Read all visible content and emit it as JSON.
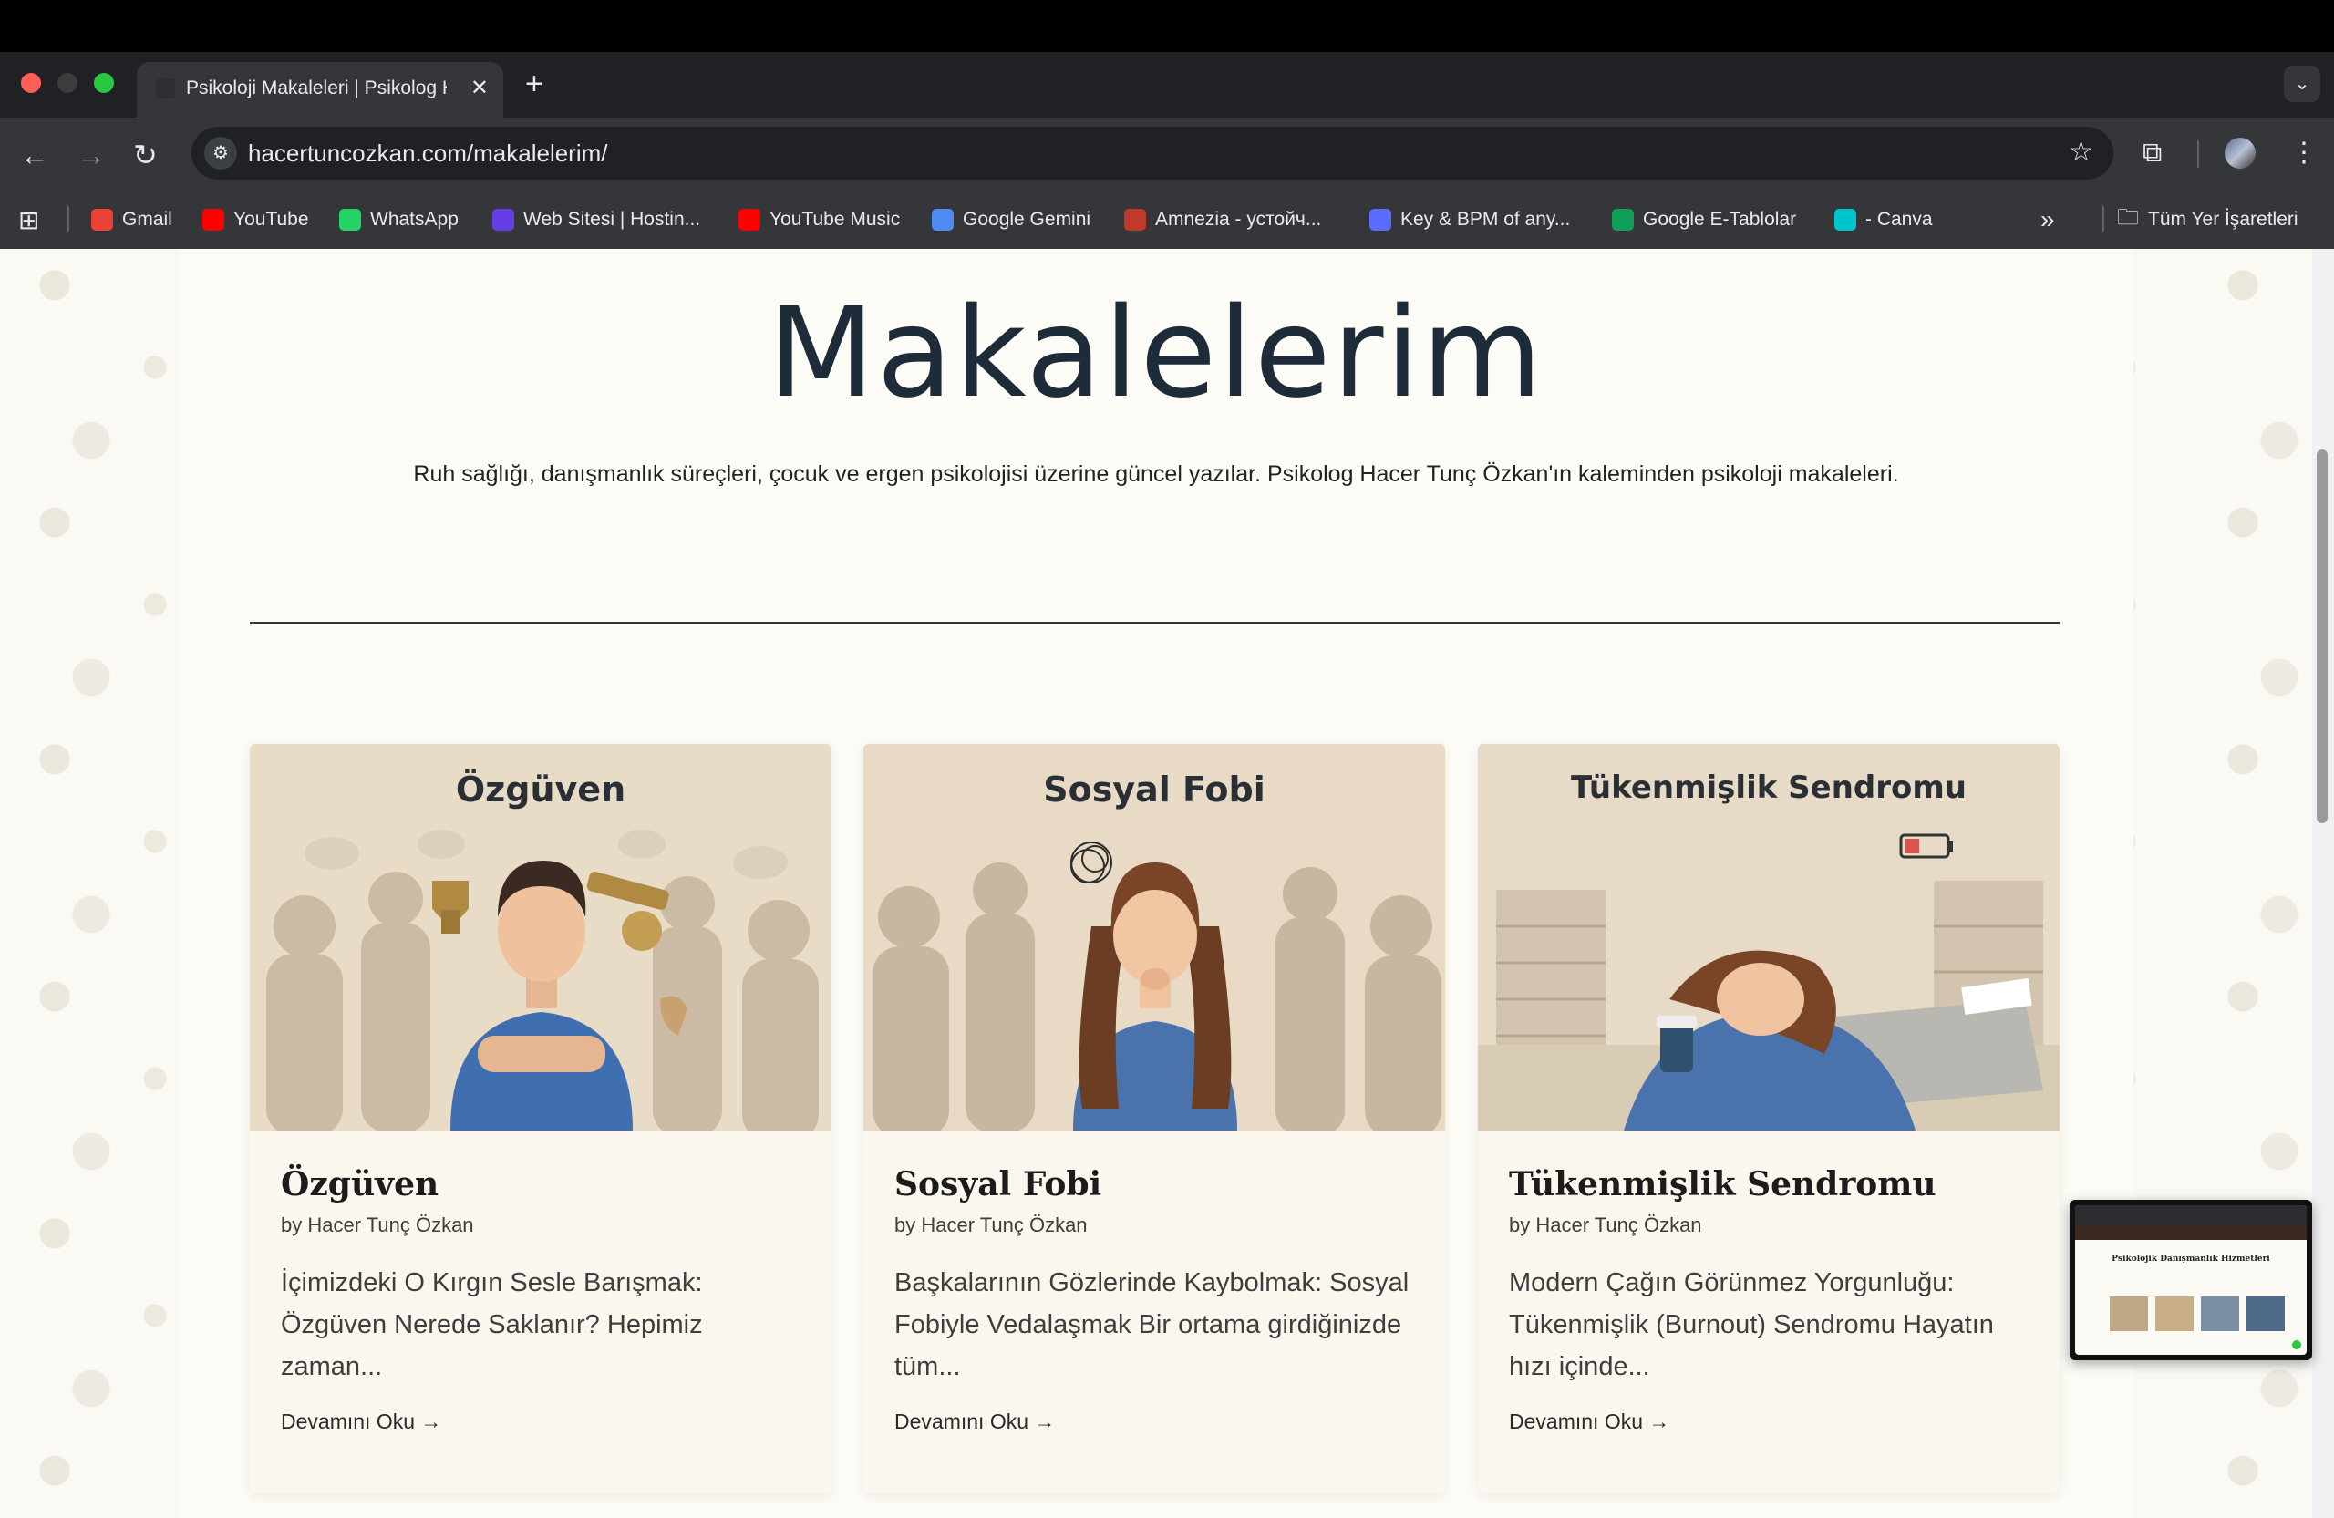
{
  "browser": {
    "tab_title": "Psikoloji Makaleleri | Psikolog Hacer Tunç Özkan",
    "tab_close": "✕",
    "new_tab": "+",
    "url": "hacertuncozkan.com/makalelerim/",
    "bookmarks": [
      {
        "label": "Gmail",
        "icon": "gmail-icon",
        "color": "#ea4335"
      },
      {
        "label": "YouTube",
        "icon": "youtube-icon",
        "color": "#ff0000"
      },
      {
        "label": "WhatsApp",
        "icon": "whatsapp-icon",
        "color": "#25d366"
      },
      {
        "label": "Web Sitesi | Hostin...",
        "icon": "hostinger-icon",
        "color": "#673de6"
      },
      {
        "label": "YouTube Music",
        "icon": "youtube-music-icon",
        "color": "#ff0000"
      },
      {
        "label": "Google Gemini",
        "icon": "gemini-icon",
        "color": "#4f8bf5"
      },
      {
        "label": "Amnezia - устойч...",
        "icon": "amnezia-icon",
        "color": "#c0392b"
      },
      {
        "label": "Key & BPM of any...",
        "icon": "music-note-icon",
        "color": "#5b6cff"
      },
      {
        "label": "Google E-Tablolar",
        "icon": "sheets-icon",
        "color": "#0f9d58"
      },
      {
        "label": "- Canva",
        "icon": "canva-icon",
        "color": "#00c4cc"
      }
    ],
    "overflow_label": "»",
    "all_bookmarks": "Tüm Yer İşaretleri"
  },
  "page": {
    "title": "Makalelerim",
    "subtitle": "Ruh sağlığı, danışmanlık süreçleri, çocuk ve ergen psikolojisi üzerine güncel yazılar. Psikolog Hacer Tunç Özkan'ın kaleminden psikoloji makaleleri."
  },
  "articles": [
    {
      "image_heading": "Özgüven",
      "title": "Özgüven",
      "author": "by Hacer Tunç Özkan",
      "excerpt": "İçimizdeki O Kırgın Sesle Barışmak: Özgüven Nerede Saklanır? Hepimiz zaman...",
      "more": "Devamını Oku →"
    },
    {
      "image_heading": "Sosyal Fobi",
      "title": "Sosyal Fobi",
      "author": "by Hacer Tunç Özkan",
      "excerpt": "Başkalarının Gözlerinde Kaybolmak: Sosyal Fobiyle Vedalaşmak Bir ortama girdiğinizde tüm...",
      "more": "Devamını Oku →"
    },
    {
      "image_heading": "Tükenmişlik Sendromu",
      "title": "Tükenmişlik Sendromu",
      "author": "by Hacer Tunç Özkan",
      "excerpt": "Modern Çağın Görünmez Yorgunluğu: Tükenmişlik (Burnout) Sendromu Hayatın hızı içinde...",
      "more": "Devamını Oku →"
    }
  ],
  "preview": {
    "title": "Psikolojik Danışmanlık Hizmetleri"
  }
}
